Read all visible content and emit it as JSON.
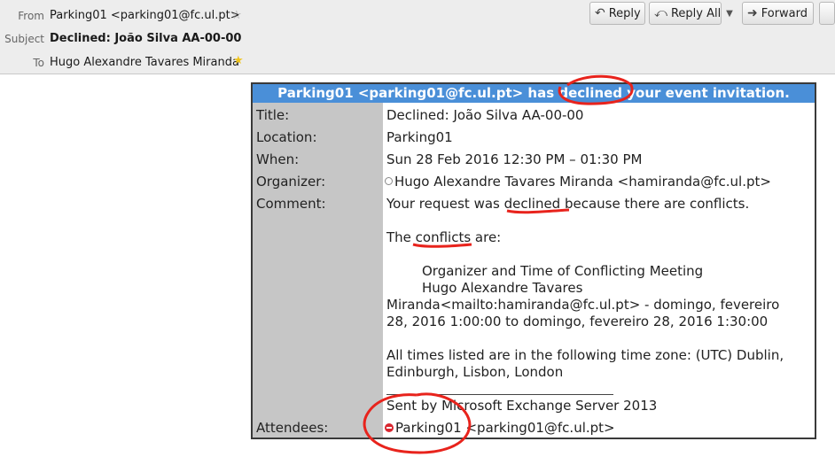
{
  "header": {
    "from_label": "From",
    "from_value": "Parking01 <parking01@fc.ul.pt>",
    "subject_label": "Subject",
    "subject_value": "Declined: João Silva AA-00-00",
    "to_label": "To",
    "to_value": "Hugo Alexandre Tavares Miranda"
  },
  "toolbar": {
    "reply_label": "Reply",
    "reply_all_label": "Reply All",
    "forward_label": "Forward"
  },
  "invite": {
    "banner": "Parking01 <parking01@fc.ul.pt> has declined your event invitation.",
    "labels": {
      "title": "Title:",
      "location": "Location:",
      "when": "When:",
      "organizer": "Organizer:",
      "comment": "Comment:",
      "attendees": "Attendees:"
    },
    "title": "Declined: João Silva AA-00-00",
    "location": "Parking01",
    "when": "Sun 28 Feb 2016 12:30 PM – 01:30 PM",
    "organizer": "Hugo Alexandre Tavares Miranda <hamiranda@fc.ul.pt>",
    "comment_lines": [
      "Your request was declined because there are conflicts.",
      "The conflicts are:",
      "Organizer and Time of Conflicting Meeting",
      "Hugo Alexandre Tavares",
      "Miranda<mailto:hamiranda@fc.ul.pt> - domingo, fevereiro",
      "28, 2016 1:00:00 to domingo, fevereiro 28, 2016 1:30:00",
      "All times listed are in the following time zone: (UTC) Dublin,",
      "Edinburgh, Lisbon, London",
      "Sent by Microsoft Exchange Server 2013"
    ],
    "attendee_name": "Parking01",
    "attendee_email": "<parking01@fc.ul.pt>"
  },
  "colors": {
    "banner": "#4a8fd8",
    "label_column": "#c6c6c6",
    "annotation": "#e8231c",
    "declined_status": "#d9262f"
  }
}
